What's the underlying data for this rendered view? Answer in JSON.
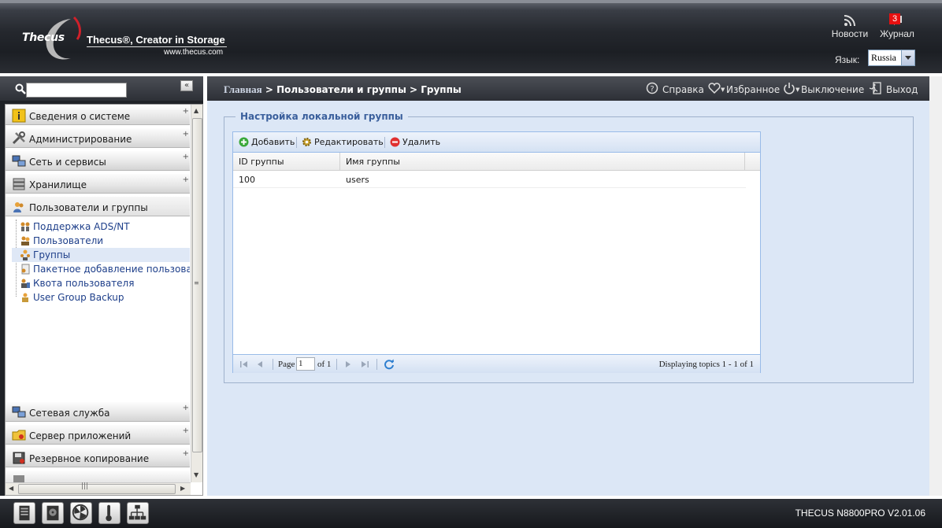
{
  "header": {
    "logo_brand": "Thecus",
    "logo_tagline": "Thecus®, Creator in Storage",
    "logo_url": "www.thecus.com",
    "news_label": "Новости",
    "log_label": "Журнал",
    "log_badge": "3",
    "lang_label": "Язык:",
    "lang_value": "Russia"
  },
  "sidebar": {
    "collapse_glyph": "«",
    "search_placeholder": "",
    "sections": [
      {
        "label": "Сведения о системе",
        "icon": "info-icon"
      },
      {
        "label": "Администрирование",
        "icon": "tools-icon"
      },
      {
        "label": "Сеть и сервисы",
        "icon": "network-icon"
      },
      {
        "label": "Хранилище",
        "icon": "storage-icon"
      },
      {
        "label": "Пользователи и группы",
        "icon": "users-icon"
      }
    ],
    "sub_items": [
      {
        "label": "Поддержка ADS/NT",
        "icon": "ads-icon"
      },
      {
        "label": "Пользователи",
        "icon": "user-icon"
      },
      {
        "label": "Группы",
        "icon": "group-icon"
      },
      {
        "label": "Пакетное добавление пользователей",
        "icon": "batch-icon"
      },
      {
        "label": "Квота пользователя",
        "icon": "quota-icon"
      },
      {
        "label": "User Group Backup",
        "icon": "backup-icon"
      }
    ],
    "bottom_sections": [
      {
        "label": "Сетевая служба",
        "icon": "network-service-icon"
      },
      {
        "label": "Сервер приложений",
        "icon": "app-server-icon"
      },
      {
        "label": "Резервное копирование",
        "icon": "backup-copy-icon"
      }
    ]
  },
  "main": {
    "breadcrumb_home": "Главная",
    "breadcrumb_rest": " > Пользователи и группы > Группы",
    "actions": {
      "help": "Справка",
      "favorites": "Избранное",
      "power": "Выключение",
      "logout": "Выход"
    },
    "panel_title": "Настройка локальной группы",
    "toolbar": {
      "add": "Добавить",
      "edit": "Редактировать",
      "delete": "Удалить"
    },
    "columns": [
      "ID группы",
      "Имя группы"
    ],
    "rows": [
      {
        "id": "100",
        "name": "users"
      }
    ],
    "pager": {
      "page_label": "Page",
      "page_value": "1",
      "of_label": "of 1",
      "display": "Displaying topics 1 - 1 of 1"
    }
  },
  "footer": {
    "version": "THECUS N8800PRO V2.01.06"
  },
  "colors": {
    "accent": "#3a5f9c",
    "main_bg": "#dce7f6",
    "link": "#1e3f8a"
  }
}
